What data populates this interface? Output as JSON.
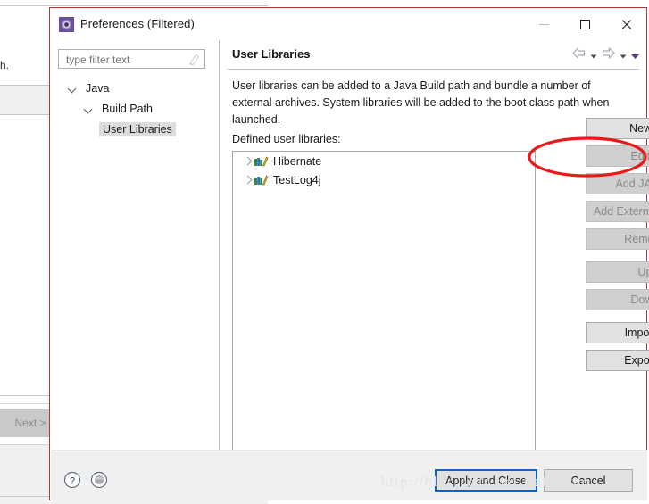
{
  "background_window": {
    "visible_text": "h.",
    "next_button": "Next >"
  },
  "dialog": {
    "title": "Preferences (Filtered)",
    "title_icon": "preferences-gear-icon",
    "window_controls": {
      "minimize": "minimize-icon",
      "maximize": "maximize-icon",
      "close": "close-icon"
    },
    "border_color": "#b03a3a"
  },
  "filter": {
    "placeholder": "type filter text",
    "value": "",
    "clear_icon": "clear-filter-icon"
  },
  "tree": {
    "items": [
      {
        "label": "Java",
        "level": 1,
        "expanded": true,
        "selected": false
      },
      {
        "label": "Build Path",
        "level": 2,
        "expanded": true,
        "selected": false
      },
      {
        "label": "User Libraries",
        "level": 3,
        "expanded": false,
        "selected": true
      }
    ]
  },
  "page": {
    "title": "User Libraries",
    "nav": {
      "back_icon": "back-arrow-icon",
      "back_caret_icon": "chevron-down-icon",
      "forward_icon": "forward-arrow-icon",
      "forward_caret_icon": "chevron-down-icon",
      "menu_caret_icon": "view-menu-icon"
    },
    "description": "User libraries can be added to a Java Build path and bundle a number of external archives. System libraries will be added to the boot class path when launched.",
    "defined_label": "Defined user libraries:"
  },
  "libraries": [
    {
      "name": "Hibernate",
      "icon": "library-books-icon",
      "expanded": false
    },
    {
      "name": "TestLog4j",
      "icon": "library-books-icon",
      "expanded": false
    }
  ],
  "side_buttons": [
    {
      "label": "New...",
      "enabled": true,
      "gap_before": false
    },
    {
      "label": "Edit...",
      "enabled": false,
      "gap_before": false
    },
    {
      "label": "Add JARs...",
      "enabled": false,
      "gap_before": false
    },
    {
      "label": "Add External JARs...",
      "enabled": false,
      "gap_before": false
    },
    {
      "label": "Remove",
      "enabled": false,
      "gap_before": false
    },
    {
      "label": "Up",
      "enabled": false,
      "gap_before": true
    },
    {
      "label": "Down",
      "enabled": false,
      "gap_before": false
    },
    {
      "label": "Import...",
      "enabled": true,
      "gap_before": true
    },
    {
      "label": "Export...",
      "enabled": true,
      "gap_before": false
    }
  ],
  "footer": {
    "help_icon": "help-icon",
    "restore_icon": "restore-defaults-icon",
    "apply_and_close": "Apply and Close",
    "cancel": "Cancel"
  },
  "annotation": {
    "shape": "red-ellipse",
    "target": "New...",
    "color": "#e81a1a"
  },
  "watermark": "http://blog.csdn.net/BakBeom"
}
